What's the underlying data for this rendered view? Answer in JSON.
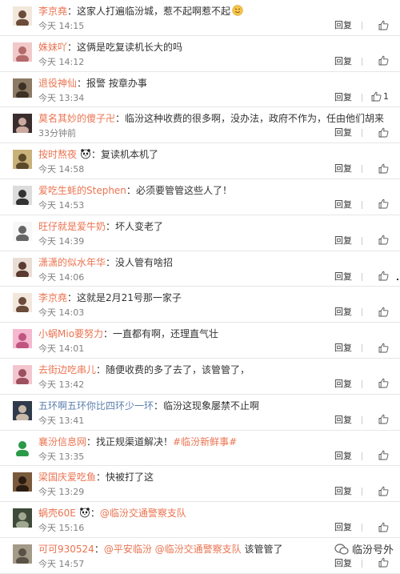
{
  "labels": {
    "reply": "回复"
  },
  "colors": {
    "username": "#eb7350",
    "text": "#333333",
    "time": "#808080"
  },
  "comments": [
    {
      "user": "李京堯",
      "text": "这家人打遍临汾城，惹不起啊惹不起",
      "time": "今天 14:15",
      "like_count": "",
      "avatar": "avatar-girl-cartoon",
      "extra_icon": "smile-emoji-icon"
    },
    {
      "user": "姝妹吖",
      "text": "这俩是吃复读机长大的吗",
      "time": "今天 14:12",
      "like_count": "",
      "avatar": "avatar-pink"
    },
    {
      "user": "退役神仙",
      "text": "报警  按章办事",
      "time": "今天 13:34",
      "like_count": "1",
      "avatar": "avatar-man-brown"
    },
    {
      "user": "莫名其妙的傻子卍",
      "text": "临汾这种收费的很多啊，没办法，政府不作为，任由他们胡来",
      "time": "33分钟前",
      "like_count": "",
      "avatar": "avatar-girl-dark"
    },
    {
      "user": "按时熬夜",
      "text": "复读机本机了",
      "time": "今天 14:58",
      "like_count": "",
      "avatar": "avatar-man-yellow",
      "extra_icon": "panda-icon"
    },
    {
      "user": "爱吃生蚝的Stephen",
      "text": "必须要管管这些人了！",
      "time": "今天 14:53",
      "like_count": "",
      "avatar": "avatar-man-glasses"
    },
    {
      "user": "旺仔就是爱牛奶",
      "text": "坏人变老了",
      "time": "今天 14:39",
      "like_count": "",
      "avatar": "avatar-cartoon-white"
    },
    {
      "user": "潇潇的似水年华",
      "text": "没人管有啥招",
      "time": "今天 14:06",
      "like_count": "",
      "avatar": "avatar-girl-anime"
    },
    {
      "user": "李京堯",
      "text": "这就是2月21号那一家子",
      "time": "今天 14:03",
      "like_count": "",
      "avatar": "avatar-girl-cartoon"
    },
    {
      "user": "小蜗Mio要努力",
      "text": "一直都有啊，还理直气壮",
      "time": "今天 14:01",
      "like_count": "",
      "avatar": "avatar-pink-round"
    },
    {
      "user": "去街边吃串儿",
      "text": "随便收费的多了去了，该管管了，",
      "time": "今天 13:42",
      "like_count": "",
      "avatar": "avatar-pink-hat"
    },
    {
      "user": "五环啊五环你比四环少一环",
      "text": "临汾这现象屡禁不止啊",
      "time": "今天 13:41",
      "like_count": "",
      "avatar": "avatar-man-dark",
      "user_color": "blue"
    },
    {
      "user": "襄汾信息网",
      "text": "找正规渠道解决！",
      "tail": "#临汾新鲜事#",
      "time": "今天 13:35",
      "like_count": "",
      "avatar": "avatar-logo-green"
    },
    {
      "user": "梁国庆爱吃鱼",
      "text": "快被打了这",
      "time": "今天 13:29",
      "like_count": "",
      "avatar": "avatar-brown"
    },
    {
      "user": "蜗壳60E",
      "text": "",
      "tail": "@临汾交通警察支队",
      "time": "今天 15:16",
      "like_count": "",
      "avatar": "avatar-dark-scene",
      "extra_icon": "panda-icon"
    },
    {
      "user": "可可930524",
      "text": "",
      "tail": "@平安临汾 @临汾交通警察支队",
      "tail_after": " 该管管了",
      "time": "今天 14:57",
      "like_count": "",
      "avatar": "avatar-road"
    }
  ],
  "watermark": "临汾号外"
}
